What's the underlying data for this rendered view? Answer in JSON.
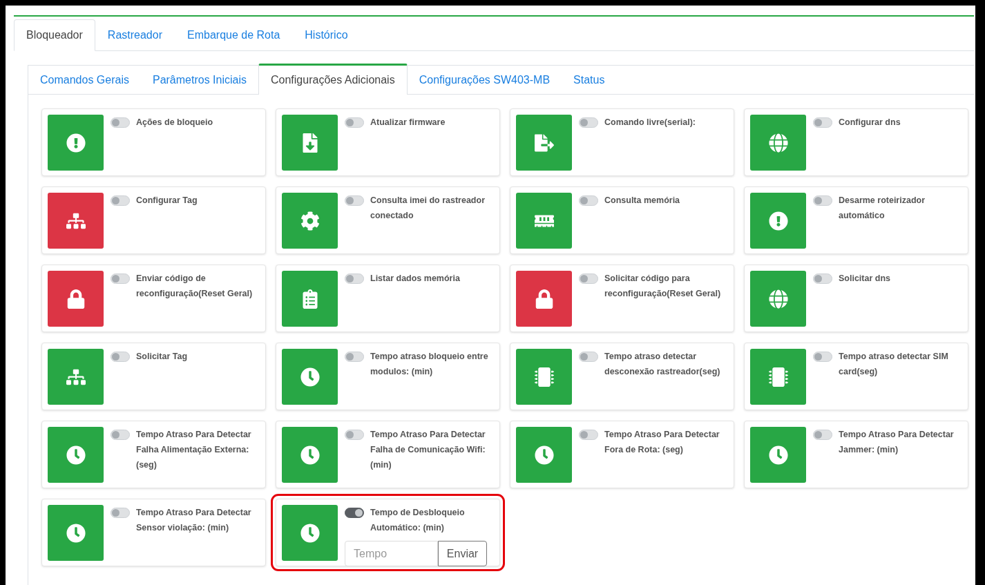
{
  "main_tabs": [
    {
      "label": "Bloqueador",
      "selected": true
    },
    {
      "label": "Rastreador",
      "selected": false
    },
    {
      "label": "Embarque de Rota",
      "selected": false
    },
    {
      "label": "Histórico",
      "selected": false
    }
  ],
  "sub_tabs": [
    {
      "label": "Comandos Gerais",
      "selected": false
    },
    {
      "label": "Parâmetros Iniciais",
      "selected": false
    },
    {
      "label": "Configurações Adicionais",
      "selected": true
    },
    {
      "label": "Configurações SW403-MB",
      "selected": false
    },
    {
      "label": "Status",
      "selected": false
    }
  ],
  "cards": [
    {
      "label": "Ações de bloqueio",
      "kind": "alert",
      "color": "#28a745",
      "on": false
    },
    {
      "label": "Atualizar firmware",
      "kind": "download",
      "color": "#28a745",
      "on": false
    },
    {
      "label": "Comando livre(serial):",
      "kind": "export",
      "color": "#28a745",
      "on": false
    },
    {
      "label": "Configurar dns",
      "kind": "globe",
      "color": "#28a745",
      "on": false
    },
    {
      "label": "Configurar Tag",
      "kind": "hierarchy",
      "color": "#dc3545",
      "on": false
    },
    {
      "label": "Consulta imei do rastreador conectado",
      "kind": "settings",
      "color": "#28a745",
      "on": false
    },
    {
      "label": "Consulta memória",
      "kind": "memory",
      "color": "#28a745",
      "on": false
    },
    {
      "label": "Desarme roteirizador automático",
      "kind": "alert",
      "color": "#28a745",
      "on": false
    },
    {
      "label": "Enviar código de reconfiguração(Reset Geral)",
      "kind": "lock",
      "color": "#dc3545",
      "on": false
    },
    {
      "label": "Listar dados memória",
      "kind": "clipboard",
      "color": "#28a745",
      "on": false
    },
    {
      "label": "Solicitar código para reconfiguração(Reset Geral)",
      "kind": "lock",
      "color": "#dc3545",
      "on": false
    },
    {
      "label": "Solicitar dns",
      "kind": "globe",
      "color": "#28a745",
      "on": false
    },
    {
      "label": "Solicitar Tag",
      "kind": "hierarchy",
      "color": "#28a745",
      "on": false
    },
    {
      "label": "Tempo atraso bloqueio entre modulos: (min)",
      "kind": "clock",
      "color": "#28a745",
      "on": false
    },
    {
      "label": "Tempo atraso detectar desconexão rastreador(seg)",
      "kind": "chip",
      "color": "#28a745",
      "on": false
    },
    {
      "label": "Tempo atraso detectar SIM card(seg)",
      "kind": "chip",
      "color": "#28a745",
      "on": false
    },
    {
      "label": "Tempo Atraso Para Detectar Falha Alimentação Externa: (seg)",
      "kind": "clock",
      "color": "#28a745",
      "on": false
    },
    {
      "label": "Tempo Atraso Para Detectar Falha de Comunicação Wifi: (min)",
      "kind": "clock",
      "color": "#28a745",
      "on": false
    },
    {
      "label": "Tempo Atraso Para Detectar Fora de Rota: (seg)",
      "kind": "clock",
      "color": "#28a745",
      "on": false
    },
    {
      "label": "Tempo Atraso Para Detectar Jammer: (min)",
      "kind": "clock",
      "color": "#28a745",
      "on": false
    },
    {
      "label": "Tempo Atraso Para Detectar Sensor violação: (min)",
      "kind": "clock",
      "color": "#28a745",
      "on": false
    },
    {
      "label": "Tempo de Desbloqueio Automático: (min)",
      "kind": "clock",
      "color": "#28a745",
      "on": true,
      "highlighted": true,
      "input": {
        "placeholder": "Tempo",
        "button": "Enviar"
      }
    }
  ]
}
